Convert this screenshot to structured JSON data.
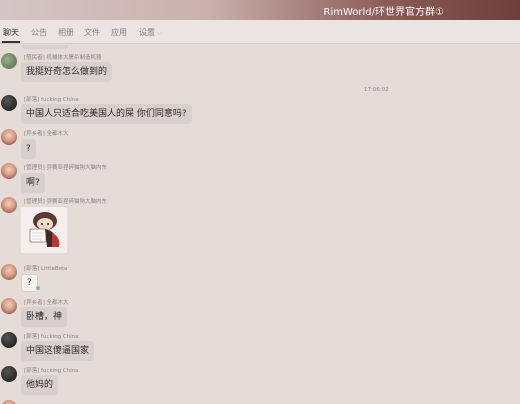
{
  "window": {
    "title": "RimWorld/环世界官方群①"
  },
  "tabs": [
    {
      "label": "聊天"
    },
    {
      "label": "公告"
    },
    {
      "label": "相册"
    },
    {
      "label": "文件"
    },
    {
      "label": "应用"
    },
    {
      "label": "设置"
    }
  ],
  "timestamp": "17:06:02",
  "messages": [
    {
      "sender": "[殖民者] 机械体大屠杀制造机器",
      "text": "我挺好奇怎么做到的"
    },
    {
      "sender": "[部落] fucking China",
      "text": "中国人只适合吃美国人的屎  你们同意吗?"
    },
    {
      "sender": "[异乡者] 全都木大",
      "text": "?"
    },
    {
      "sender": "[管理员] 弥赛亚捏碎猫狗大脑内东",
      "text": "啊?"
    },
    {
      "sender": "[管理员] 弥赛亚捏碎猫狗大脑内东",
      "text": "",
      "sticker": "sticker-image"
    },
    {
      "sender": "[部落] LittleBeta",
      "text": "?"
    },
    {
      "sender": "[异乡者] 全都木大",
      "text": "卧槽，神"
    },
    {
      "sender": "[部落] fucking China",
      "text": "中国这傻逼国家"
    },
    {
      "sender": "[部落] fucking China",
      "text": "他妈的"
    }
  ],
  "colors": {
    "background": "#e5dcd8",
    "bubble": "#d9cfcc",
    "accent": "#6e3f3a"
  }
}
